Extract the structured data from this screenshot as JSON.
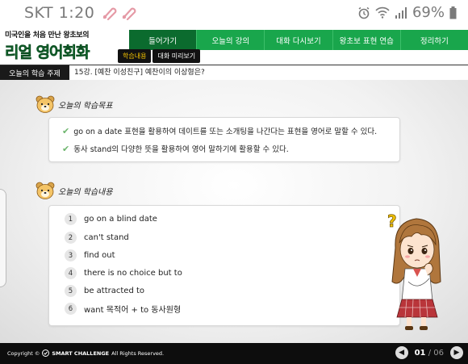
{
  "status_bar": {
    "carrier_time": "SKT 1:20",
    "battery": "69%"
  },
  "logo": {
    "top_text": "미국인을 처음 만난 왕초보의",
    "main_text": "리얼 영어회화"
  },
  "nav": {
    "items": [
      {
        "label": "들어가기",
        "active": true
      },
      {
        "label": "오늘의 강의",
        "active": false
      },
      {
        "label": "대화 다시보기",
        "active": false
      },
      {
        "label": "왕초보 표현 연습",
        "active": false
      },
      {
        "label": "정리하기",
        "active": false
      }
    ]
  },
  "subtabs": [
    {
      "label": "학습내용",
      "active": true
    },
    {
      "label": "대화 미리보기",
      "active": false
    }
  ],
  "topic": {
    "label": "오늘의 학습 주제",
    "text": "15강. [예찬 이성친구] 예찬이의 이상형은?"
  },
  "goals": {
    "title": "오늘의 학습목표",
    "items": [
      "go on a date 표현을 활용하여 데이트를 또는 소개팅을 나간다는 표현을 영어로 말할 수 있다.",
      "동사 stand의 다양한 뜻을 활용하여 영어 말하기에 활용할 수 있다."
    ]
  },
  "contents": {
    "title": "오늘의 학습내용",
    "items": [
      {
        "num": "1",
        "text": "go on a blind date"
      },
      {
        "num": "2",
        "text": "can't stand"
      },
      {
        "num": "3",
        "text": "find out"
      },
      {
        "num": "4",
        "text": "there is no choice but to"
      },
      {
        "num": "5",
        "text": "be attracted to"
      },
      {
        "num": "6",
        "text": "want 목적어 + to 동사원형"
      }
    ]
  },
  "footer": {
    "copyright_prefix": "Copyright ©",
    "brand": "SMART CHALLENGE",
    "rights": "All Rights Reserved.",
    "current_page": "01",
    "separator": "/",
    "total_pages": "06"
  },
  "colors": {
    "nav_green": "#19a64c",
    "nav_active": "#0b6b2e",
    "subtab_active": "#f5c400",
    "check_green": "#6db56d"
  }
}
